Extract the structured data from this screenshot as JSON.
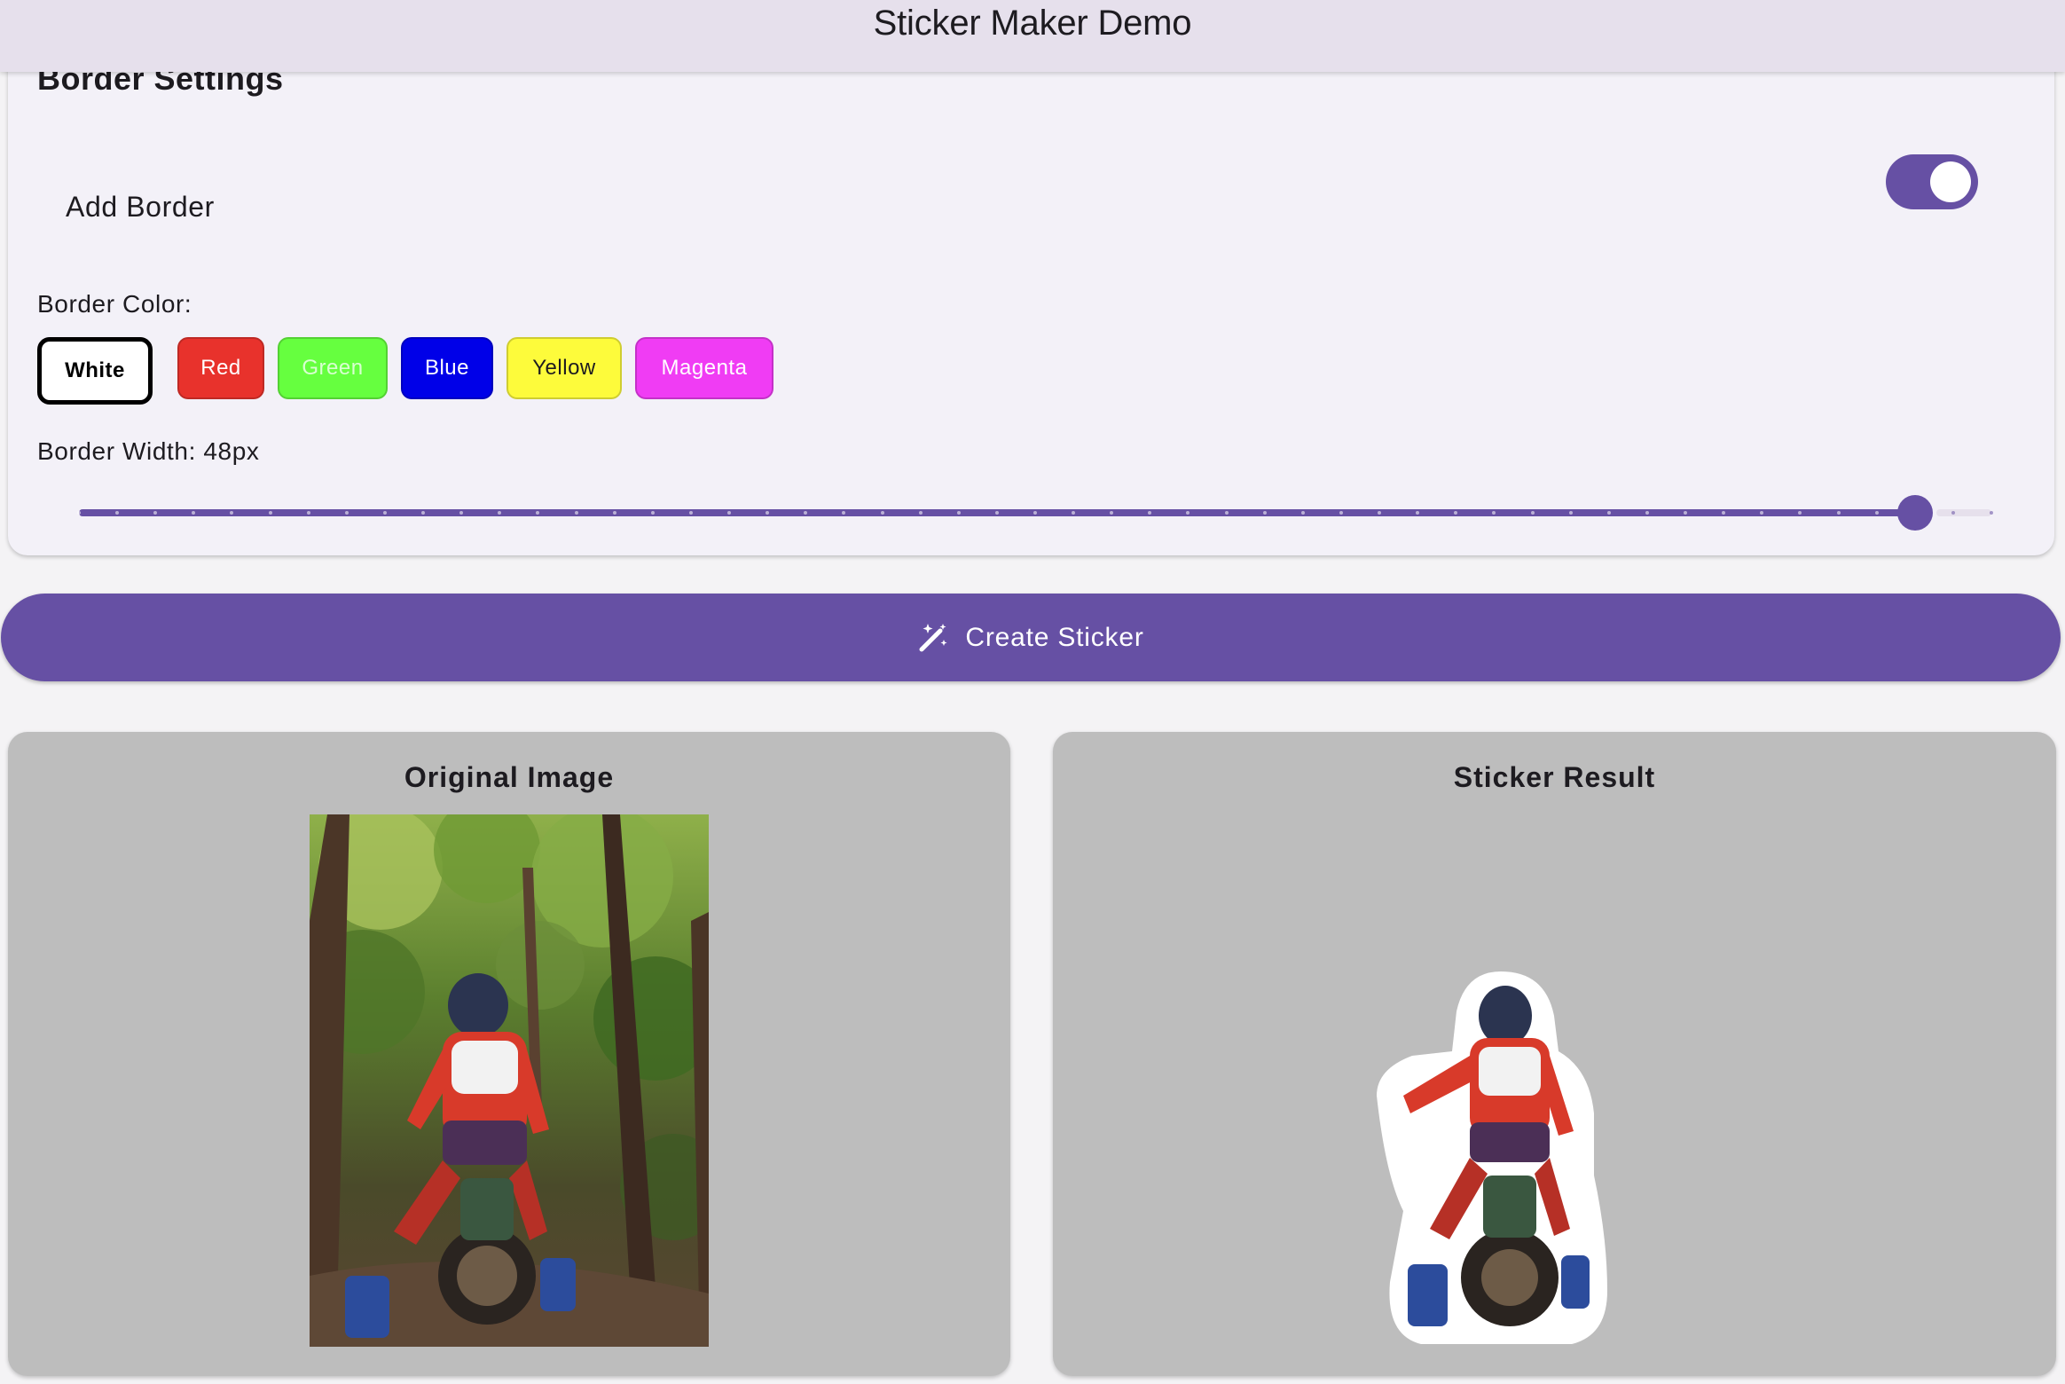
{
  "app": {
    "title": "Sticker Maker Demo"
  },
  "border_settings": {
    "title": "Border Settings",
    "add_border_label": "Add Border",
    "add_border_enabled": true,
    "color_label": "Border Color:",
    "colors": [
      {
        "label": "White",
        "bg": "#ffffff",
        "fg": "#000000",
        "selected": true
      },
      {
        "label": "Red",
        "bg": "#e8322c",
        "fg": "#ffffff",
        "selected": false
      },
      {
        "label": "Green",
        "bg": "#66ff3f",
        "fg": "#d8ffd0",
        "selected": false
      },
      {
        "label": "Blue",
        "bg": "#0000e8",
        "fg": "#ffffff",
        "selected": false
      },
      {
        "label": "Yellow",
        "bg": "#fdfb3b",
        "fg": "#1d1b20",
        "selected": false
      },
      {
        "label": "Magenta",
        "bg": "#f03cf4",
        "fg": "#ffffff",
        "selected": false
      }
    ],
    "width_label": "Border Width: 48px",
    "slider": {
      "value": 48,
      "min": 0,
      "max": 50
    }
  },
  "actions": {
    "create_label": "Create Sticker",
    "create_icon": "auto-fix-wand-icon"
  },
  "panels": {
    "original_title": "Original Image",
    "result_title": "Sticker Result"
  },
  "colors": {
    "primary": "#6650a4",
    "app_bar": "#e6e0ec",
    "card": "#f3f1f8",
    "panel": "#bdbdbd"
  }
}
